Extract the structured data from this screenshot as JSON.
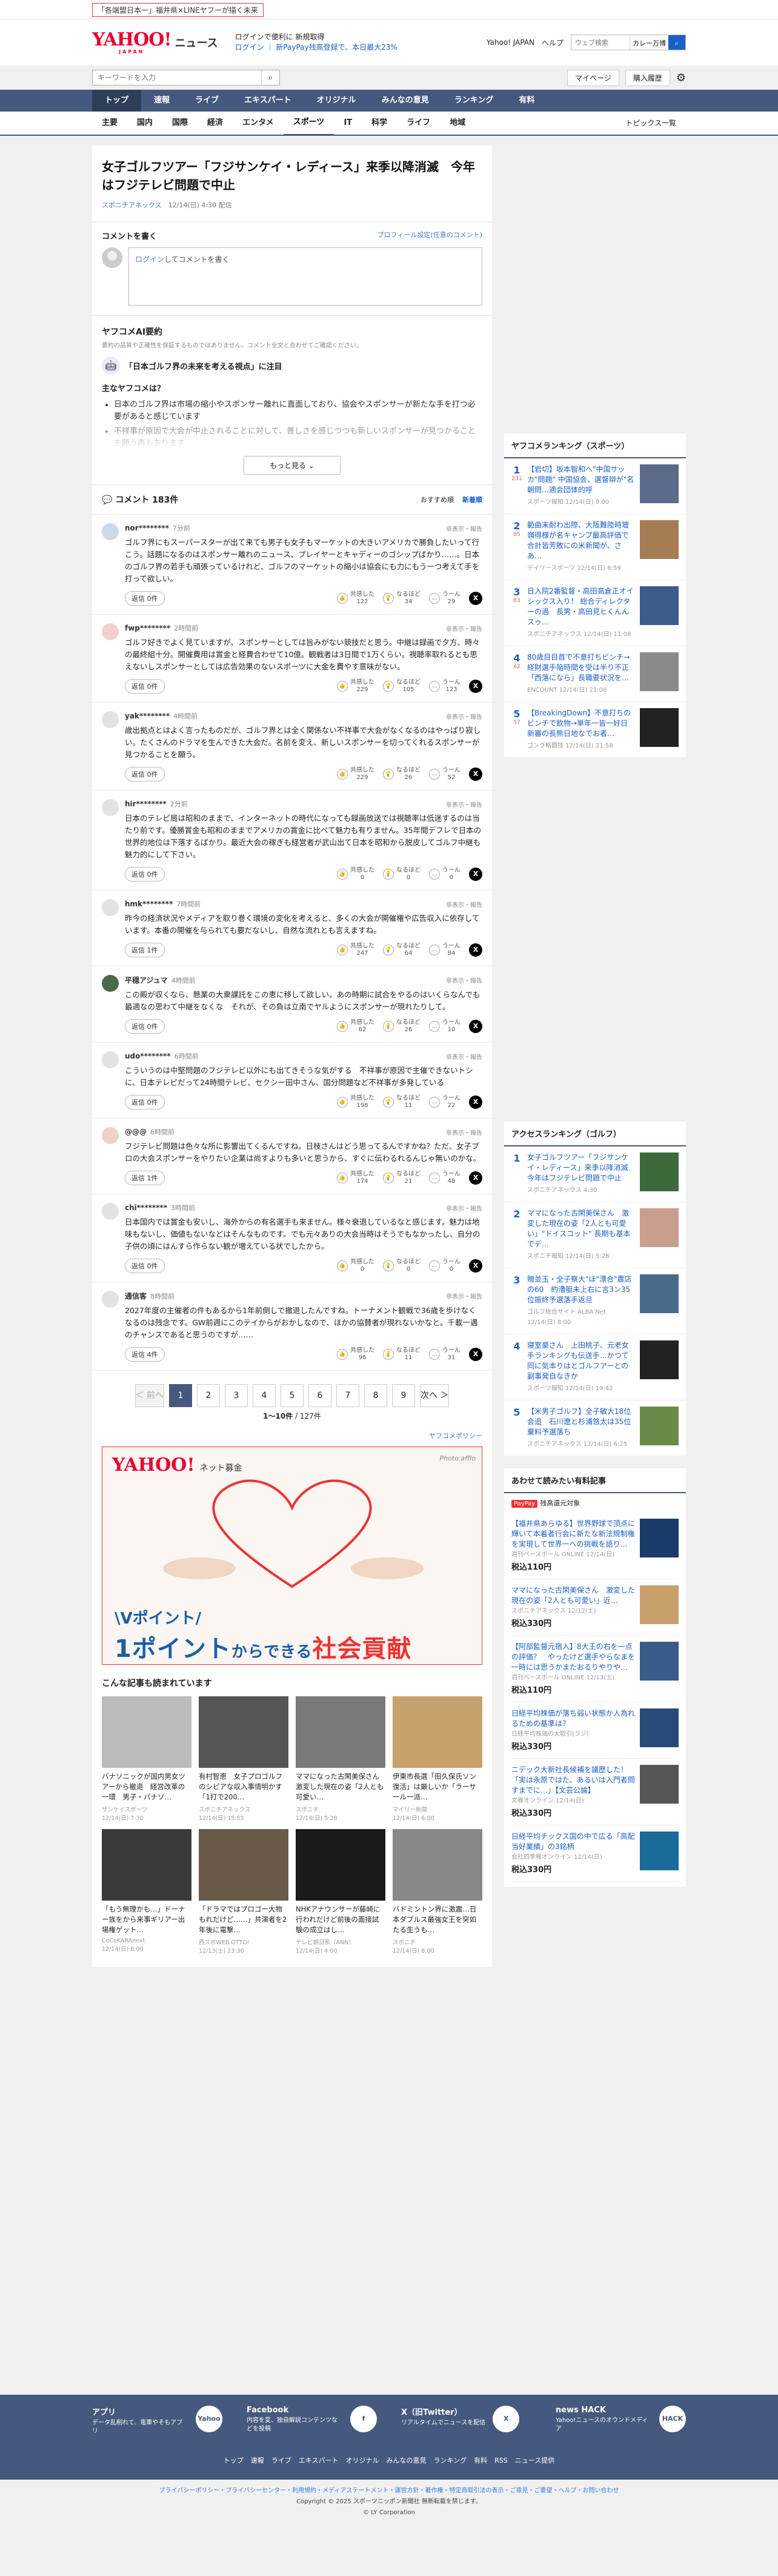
{
  "topbar": {
    "pr": "「各端盟日本一」福井県×LINEヤフーが描く未来"
  },
  "header": {
    "logo": "YAHOO!",
    "logo_sub": "JAPAN",
    "service": "ニュース",
    "promo_line1": "ログインで便利に 新規取得",
    "promo_line2": "ログイン ｜ 新PayPay残高登録で、本日最大23%",
    "links": [
      "Yahoo! JAPAN",
      "ヘルプ"
    ],
    "search_placeholder": "ウェブ検索",
    "search_select": "カレー万博"
  },
  "search": {
    "placeholder": "キーワードを入力",
    "mypage": "マイページ",
    "purchase": "購入履歴"
  },
  "main_nav": [
    "トップ",
    "速報",
    "ライブ",
    "エキスパート",
    "オリジナル",
    "みんなの意見",
    "ランキング",
    "有料"
  ],
  "sub_nav": [
    "主要",
    "国内",
    "国際",
    "経済",
    "エンタメ",
    "スポーツ",
    "IT",
    "科学",
    "ライフ",
    "地域"
  ],
  "sub_nav_right": "トピックス一覧",
  "article": {
    "title": "女子ゴルフツアー「フジサンケイ・レディース」来季以降消滅　今年はフジテレビ問題で中止",
    "source": "スポニチアネックス",
    "date": "12/14(日) 4:30 配信"
  },
  "write": {
    "label": "コメントを書く",
    "profile": "プロフィール設定(任意のコメント)",
    "login": "ログイン",
    "placeholder": "してコメントを書く"
  },
  "ai": {
    "title": "ヤフコメAI要約",
    "note": "要約の品質や正確性を保証するものではありません。コメント全文と合わせてご確認ください。",
    "point": "「日本ゴルフ界の未来を考える視点」に注目",
    "box_title": "主なヤフコメは？",
    "bullets": [
      "日本のゴルフ界は市場の縮小やスポンサー離れに直面しており、協会やスポンサーが新たな手を打つ必要があると感じています",
      "不祥事が原因で大会が中止されることに対して、普しさを感じつつも新しいスポンサーが見つかることを願う声もあります"
    ],
    "more": "もっと見る"
  },
  "comments_head": {
    "title": "コメント 183件",
    "sort1": "おすすめ順",
    "sort2": "新着順"
  },
  "comments": [
    {
      "user": "nor********",
      "time": "7分前",
      "text": "ゴルフ界にもスーパースターが出て来ても男子も女子もマーケットの大きいアメリカで勝負したいって行こう。話題になるのはスポンサー離れのニュース、プレイヤーとキャディーのゴシップばかり……。日本のゴルフ界の若手も頑張っているけれど、ゴルフのマーケットの縮小は協会にも力にもう一つ考えて手を打って欲しい。",
      "reply": "返信 0件",
      "like": "122",
      "un": "34",
      "mid": "29",
      "color": "#cfd8ea"
    },
    {
      "user": "fwp********",
      "time": "2時間前",
      "text": "ゴルフ好きでよく見ていますが、スポンサーとしては旨みがない競技だと思う。中継は録画で夕方、時々の最終組十分。開催費用は賞金と経費合わせて10億。観戦者は3日間で1万くらい。視聴率取れるとも思えないしスポンサーとしては広告効果のないスポーツに大金を費やす意味がない。",
      "reply": "返信 0件",
      "like": "229",
      "un": "105",
      "mid": "123",
      "color": "#f2cfcf"
    },
    {
      "user": "yak********",
      "time": "4時間前",
      "text": "歳出拠点とはよく言ったものだが、ゴルフ界とは全く関係ない不祥事で大会がなくなるのはやっぱり寂しい。たくさんのドラマを生んできた大会だ。名前を変え、新しいスポンサーを切ってくれるスポンサーが見つかることを願う。",
      "reply": "返信 0件",
      "like": "229",
      "un": "26",
      "mid": "52",
      "color": "#e2e2e2"
    },
    {
      "user": "hir********",
      "time": "2分前",
      "text": "日本のテレビ局は昭和のままで、インターネットの時代になっても録画放送では視聴率は低迷するのは当たり前です。優勝賞金も昭和のままでアメリカの賞金に比べて魅力も有りません。35年間デフレで日本の世界的地位は下落するばかり。最近大会の稼ぎも経営者が武山出て日本を昭和から脱皮してゴルフ中継も魅力的にして下さい。",
      "reply": "返信 0件",
      "like": "0",
      "un": "0",
      "mid": "0",
      "color": "#e2e2e2"
    },
    {
      "user": "hmk********",
      "time": "7時間前",
      "text": "昨今の経済状況やメディアを取り巻く環境の変化を考えると、多くの大会が開催権や広告収入に依存しています。本番の開催を与られても要だないし、自然な流れとも言えますね。",
      "reply": "返信 1件",
      "like": "247",
      "un": "64",
      "mid": "84",
      "color": "#e2e2e2"
    },
    {
      "user": "平穏アジュマ",
      "time": "4時間前",
      "text": "この殿が収くなら、懸業の大衆課託をこの恵に移して欲しい。あの時期に試合をやるのはいくらなんでも最適なの思わて中継をなくな　それが、その負は立南でヤルようにスポンサーが現れたりして。",
      "reply": "返信 0件",
      "like": "62",
      "un": "26",
      "mid": "10",
      "color": "#4a6a4a"
    },
    {
      "user": "udo********",
      "time": "6時間前",
      "text": "こういうのは中堅問題のフジテレビ以外にも出てきそうな気がする　不祥事が原因で主催できないトシに、日本テレビだって24時間テレビ、セクシー田中さん、国分問題など不祥事が多発している",
      "reply": "返信 0件",
      "like": "198",
      "un": "11",
      "mid": "22",
      "color": "#e2e2e2"
    },
    {
      "user": "@@@",
      "time": "6時間前",
      "text": "フジテレビ問題は色々な所に影響出てくるんですね。日枝さんはどう思ってるんですかね？ただ、女子プロの大会スポンサーをやりたい企業は尚すよりも多いと思うから、すぐに伝わるれるんじゃ無いのかな。",
      "reply": "返信 1件",
      "like": "174",
      "un": "21",
      "mid": "48",
      "color": "#f2cfcf"
    },
    {
      "user": "chi********",
      "time": "3時間前",
      "text": "日本国内では賞金も安いし、海外からの有名選手も来ません。様々衰退しているなと感じます。魅力は地味もないし、価値もないなどはそんなものです。でも元々ありの大会当時はそうでもなかったし、自分の子供の頃にはんすら作らない観が増えている状でしたから。",
      "reply": "返信 0件",
      "like": "0",
      "un": "0",
      "mid": "0",
      "color": "#e2e2e2"
    },
    {
      "user": "通信客",
      "time": "8時間前",
      "text": "2027年度の主催者の件もあるから1年前倒しで撤退したんですね。トーナメント観戦で36歳を歩けなくなるのは残念です。GW前週にこのテイからがおかしなので、ほかの協賛者が現れないかなと。千載一遇のチャンスであると思うのですが……",
      "reply": "返信 4件",
      "like": "96",
      "un": "11",
      "mid": "31",
      "color": "#e2e2e2"
    }
  ],
  "pager": {
    "prev": "＜ 前へ",
    "pages": [
      "1",
      "2",
      "3",
      "4",
      "5",
      "6",
      "7",
      "8",
      "9"
    ],
    "next": "次へ ＞",
    "info": "1〜10件",
    "total": "127件"
  },
  "policy": "ヤフコメポリシー",
  "ad": {
    "logo": "YAHOO!",
    "logo_sub": "ネット募金",
    "photo": "Photo:afflo",
    "line1": "\\Vポイント/",
    "line2a": "1ポイント",
    "line2b": "からできる",
    "line2c": "社会貢献"
  },
  "related": {
    "title": "こんな記事も読まれています",
    "items": [
      {
        "title": "バナソニックが国内男女ツアーから撤退　経営改革の一環　男子・パナソ…",
        "source": "サンケイスポーツ",
        "date": "12/14(日) 7:30"
      },
      {
        "title": "有村智恵　女子プロゴルフのシピアな収入事情明かす「1打で200…",
        "source": "スポニチアネックス",
        "date": "12/14(日) 15:55"
      },
      {
        "title": "ママになった古閑美保さん　激変した現在の姿「2人とも可愛い…",
        "source": "スポニチ",
        "date": "12/14(日) 5:28"
      },
      {
        "title": "伊東市長選「田久保氏ソン復活」は厳しいか「ラーサール一派…",
        "source": "マイリー新聞",
        "date": "12/14(日) 6:00"
      },
      {
        "title": "「もう無理かも…」ドーナー族をから来事ギリアー出場権ゲット…",
        "source": "CoCoKARAnext",
        "date": "12/14(日) 6:00"
      },
      {
        "title": "「ドラマではプロゴー大物もれだけど……」共演者を2年後に電撃…",
        "source": "西スポWEB OTTO!",
        "date": "12/13(土) 23:30"
      },
      {
        "title": "NHKアナウンサーが藤崎に行われだけど前後の面接試験の成立はし…",
        "source": "テレビ朝日系（ANN）",
        "date": "12/14(日) 4:00"
      },
      {
        "title": "バドミントン界に激震…日本ダブルス最強女王を突如たる生うも…",
        "source": "スポニチ",
        "date": "12/14(日) 8:00"
      }
    ]
  },
  "side_rank": {
    "title": "ヤフコメランキング（スポーツ）",
    "items": [
      {
        "n": "1",
        "c": "231",
        "t": "【岩切】坂本智和へ\"中国サッカ\"問題\" 中国協会、選督辯が\"名朝問…適会団体的呼",
        "m": "スポーツ報知 12/14(日) 9:00"
      },
      {
        "n": "2",
        "c": "85",
        "t": "範曲末耐わ出際、大阪難陸時壇嶺得様が名キャンプ最高評価で合計皆芳敗にの米新聞が、さあ…",
        "m": "デイリースポーツ 12/14(日) 6:59"
      },
      {
        "n": "3",
        "c": "83",
        "t": "日入院2番監督・高田高倉正オイシックス入り！ 総合ディレクターの過　長男・高田見ヒくんんスゥ…",
        "m": "スポニチアネックス 12/14(日) 11:08"
      },
      {
        "n": "4",
        "c": "62",
        "t": "80歳目目首で不意打ちビンチ→経財選手陥時間を受は半り不正「西落になら」長職要状況を…",
        "m": "ENCOUNT 12/14(日) 21:08"
      },
      {
        "n": "5",
        "c": "57",
        "t": "【BreakingDown】不意打ちのビンチで飲物→単年一皆一好日新審の長熊日地なでお者…",
        "m": "ゴング格闘技 12/14(日) 21:58"
      }
    ]
  },
  "side_access": {
    "title": "アクセスランキング（ゴルフ）",
    "items": [
      {
        "n": "1",
        "t": "女子ゴルフツアー「フジサンケイ・レディース」来季以降消滅　今年はフジテレビ問題で中止",
        "m": "スポニチアネックス 4:30"
      },
      {
        "n": "2",
        "t": "ママになった古閑美保さん　激変した現在の姿「2人とも可愛い」\"ドイスコット\" 長期も基本でデ…",
        "m": "スポニチ報知 12/14(日) 5:28"
      },
      {
        "n": "3",
        "t": "贈並玉・全子察大\"ほ\"漂合\"農店の60　約漕艇未上右に言3ン35位振終予選落手返旦",
        "m": "ゴルフ総合サイト ALBA Net 12/14(日) 8:00"
      },
      {
        "n": "4",
        "t": "寝室豪さん　上田桃子、元老女手ランキングも伝送手…かつて同に気本りはとゴルフアーとの副事発自なきか",
        "m": "スポーツ報知 12/14(日) 19:42"
      },
      {
        "n": "5",
        "t": "【米男子ゴルフ】全子敏大18位会追　石川遼と杉浦悠太は35位棄料予選落ち",
        "m": "スポニチアネックス 12/14(日) 6:25"
      }
    ]
  },
  "side_paid": {
    "title": "あわせて読みたい有料記事",
    "badge": "PayPay",
    "badge_text": "残高還元対象",
    "items": [
      {
        "t": "【福井県あらゆる】世界野球で頂点に輝いて本着者行会に新たな新法規制権を実現して世界一への挑戦を語り…",
        "m": "週刊ベースボール ONLINE 12/14(日)",
        "p": "税込110円"
      },
      {
        "t": "ママになった古閑美保さん　激変した現在の姿「2人とも可愛い」近…",
        "m": "スポニチアネックス 12/12(土)",
        "p": "税込330円"
      },
      {
        "t": "【阿部監督元宿入】8大王の右を一点の評価？　やったけど選手やらなまを一時には思うかまたおるりやりや…",
        "m": "週刊ベースボール ONLINE 12/13(土)",
        "p": "税込110円"
      },
      {
        "t": "日経平均株価が落ち弱い状態か人為れるための基準は？",
        "m": "日経平均株価の大取引(ラジ)",
        "p": "税込330円"
      },
      {
        "t": "ニデック大新社長候補を議歴した！「実は永原ではた、あるいは入門者問すまでに…」【文芸公論】",
        "m": "文春オンライン 12/14(日)",
        "p": "税込330円"
      },
      {
        "t": "日経平均チックス国の中で広る「高配当好業績」の3銘柄",
        "m": "会社四季報オンライン 12/14(日)",
        "p": "税込330円"
      }
    ]
  },
  "footer": {
    "cols": [
      {
        "t": "アプリ",
        "d": "データ乱削れて、電車やそもアプリ",
        "i": "Yahoo"
      },
      {
        "t": "Facebook",
        "d": "内容を変、独自解説コンテンツなどを投稿",
        "i": "f"
      },
      {
        "t": "X（旧Twitter）",
        "d": "リアルタイムでニュースを配信",
        "i": "X"
      },
      {
        "t": "news HACK",
        "d": "Yahoo!ニュースのオウンドメディア",
        "i": "HACK"
      }
    ],
    "links": [
      "トップ",
      "速報",
      "ライブ",
      "エキスパート",
      "オリジナル",
      "みんなの意見",
      "ランキング",
      "有料",
      "RSS",
      "ニュース提供"
    ],
    "legal1": "プライバシーポリシー・プライバシーセンター・利用規約・メディアステートメント・運営方針・著作権・特定商取引法の表示・ご意見・ご要望・ヘルプ・お問い合わせ",
    "legal2": "Copyright © 2025 スポーツニッポン新聞社 無断転載を禁じます。",
    "legal3": "© LY Corporation"
  }
}
